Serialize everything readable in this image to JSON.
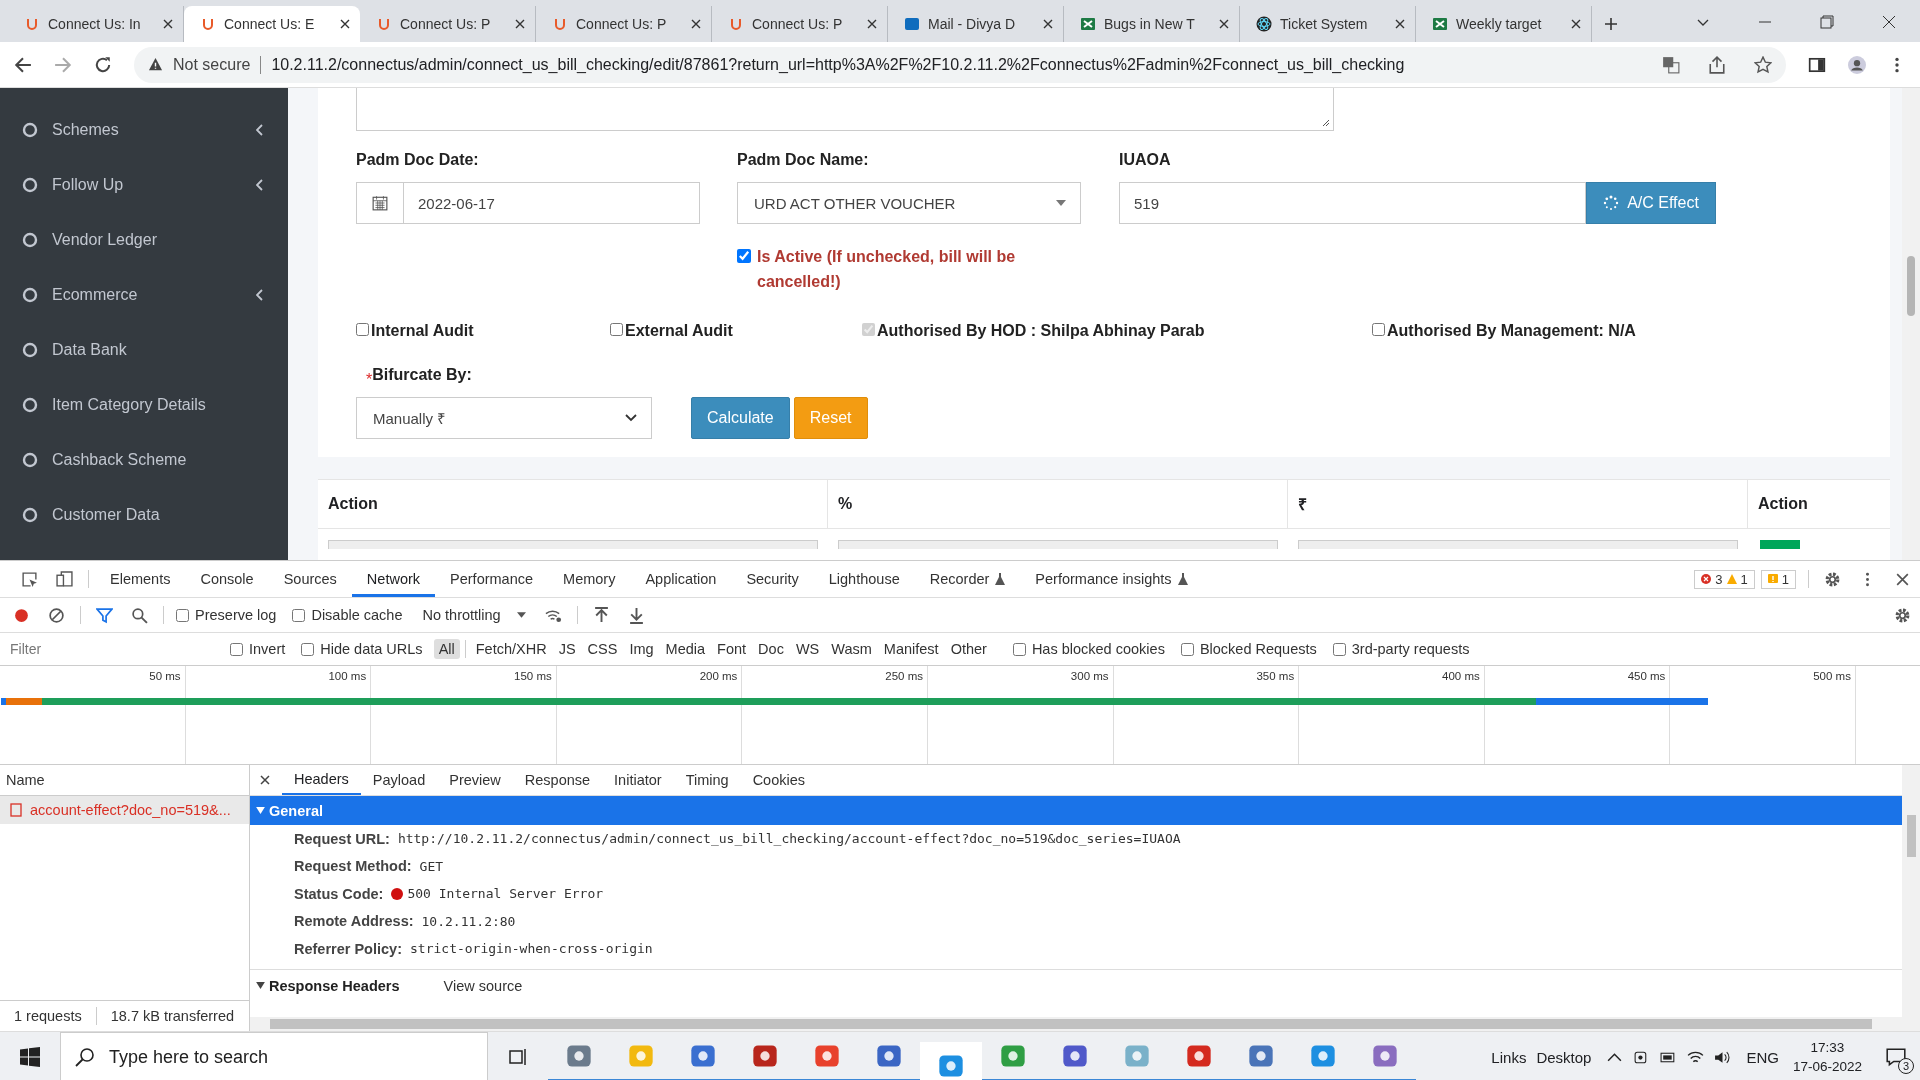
{
  "browser": {
    "tabs": [
      {
        "title": "Connect Us: In",
        "kind": "site",
        "selected": false
      },
      {
        "title": "Connect Us: E",
        "kind": "site",
        "selected": true
      },
      {
        "title": "Connect Us: P",
        "kind": "site",
        "selected": false
      },
      {
        "title": "Connect Us: P",
        "kind": "site",
        "selected": false
      },
      {
        "title": "Connect Us: P",
        "kind": "site",
        "selected": false
      },
      {
        "title": "Mail - Divya D",
        "kind": "mail",
        "selected": false
      },
      {
        "title": "Bugs in New T",
        "kind": "sheet",
        "selected": false
      },
      {
        "title": "Ticket System",
        "kind": "ticket",
        "selected": false
      },
      {
        "title": "Weekly target",
        "kind": "sheet",
        "selected": false
      }
    ],
    "address": {
      "security": "Not secure",
      "url": "10.2.11.2/connectus/admin/connect_us_bill_checking/edit/87861?return_url=http%3A%2F%2F10.2.11.2%2Fconnectus%2Fadmin%2Fconnect_us_bill_checking"
    }
  },
  "sidebar": {
    "items": [
      {
        "label": "Schemes",
        "submenu": true
      },
      {
        "label": "Follow Up",
        "submenu": true
      },
      {
        "label": "Vendor Ledger",
        "submenu": false
      },
      {
        "label": "Ecommerce",
        "submenu": true
      },
      {
        "label": "Data Bank",
        "submenu": false
      },
      {
        "label": "Item Category Details",
        "submenu": false
      },
      {
        "label": "Cashback Scheme",
        "submenu": false
      },
      {
        "label": "Customer Data",
        "submenu": false
      }
    ]
  },
  "form": {
    "date": {
      "label": "Padm Doc Date:",
      "value": "2022-06-17"
    },
    "doc_name": {
      "label": "Padm Doc Name:",
      "value": "URD ACT OTHER VOUCHER"
    },
    "iuaoa": {
      "label": "IUAOA",
      "value": "519",
      "button": "A/C Effect"
    },
    "is_active": {
      "label": "Is Active (If unchecked, bill will be cancelled!)",
      "checked": true
    },
    "audits": [
      {
        "label": "Internal Audit",
        "checked": false,
        "disabled": false
      },
      {
        "label": "External Audit",
        "checked": false,
        "disabled": false
      },
      {
        "label": "Authorised By HOD : Shilpa Abhinay Parab",
        "checked": true,
        "disabled": true
      },
      {
        "label": "Authorised By Management: N/A",
        "checked": false,
        "disabled": false
      }
    ],
    "bifurcate": {
      "required_mark": "*",
      "label": "Bifurcate By:",
      "value": "Manually ₹"
    },
    "buttons": [
      {
        "label": "Calculate",
        "kind": "primary"
      },
      {
        "label": "Reset",
        "kind": "warning"
      }
    ]
  },
  "table": {
    "columns": [
      "Action",
      "%",
      "₹",
      "Action"
    ]
  },
  "devtools": {
    "tabs": [
      {
        "label": "Elements",
        "selected": false,
        "experimental": false
      },
      {
        "label": "Console",
        "selected": false,
        "experimental": false
      },
      {
        "label": "Sources",
        "selected": false,
        "experimental": false
      },
      {
        "label": "Network",
        "selected": true,
        "experimental": false
      },
      {
        "label": "Performance",
        "selected": false,
        "experimental": false
      },
      {
        "label": "Memory",
        "selected": false,
        "experimental": false
      },
      {
        "label": "Application",
        "selected": false,
        "experimental": false
      },
      {
        "label": "Security",
        "selected": false,
        "experimental": false
      },
      {
        "label": "Lighthouse",
        "selected": false,
        "experimental": false
      },
      {
        "label": "Recorder",
        "selected": false,
        "experimental": true
      },
      {
        "label": "Performance insights",
        "selected": false,
        "experimental": true
      }
    ],
    "counts": {
      "errors": "3",
      "warnings": "1",
      "issues": "1"
    },
    "toolbar": {
      "options": [
        {
          "label": "Preserve log",
          "checked": false
        },
        {
          "label": "Disable cache",
          "checked": false
        }
      ],
      "throttling": "No throttling"
    },
    "filter": {
      "placeholder": "Filter",
      "options": [
        {
          "label": "Invert",
          "checked": false
        },
        {
          "label": "Hide data URLs",
          "checked": false
        }
      ],
      "types": [
        {
          "label": "All",
          "selected": true
        },
        {
          "label": "Fetch/XHR",
          "selected": false
        },
        {
          "label": "JS",
          "selected": false
        },
        {
          "label": "CSS",
          "selected": false
        },
        {
          "label": "Img",
          "selected": false
        },
        {
          "label": "Media",
          "selected": false
        },
        {
          "label": "Font",
          "selected": false
        },
        {
          "label": "Doc",
          "selected": false
        },
        {
          "label": "WS",
          "selected": false
        },
        {
          "label": "Wasm",
          "selected": false
        },
        {
          "label": "Manifest",
          "selected": false
        },
        {
          "label": "Other",
          "selected": false
        }
      ],
      "extra": [
        {
          "label": "Has blocked cookies",
          "checked": false
        },
        {
          "label": "Blocked Requests",
          "checked": false
        },
        {
          "label": "3rd-party requests",
          "checked": false
        }
      ]
    },
    "timeline": {
      "ticks": [
        "50 ms",
        "100 ms",
        "150 ms",
        "200 ms",
        "250 ms",
        "300 ms",
        "350 ms",
        "400 ms",
        "450 ms",
        "500 ms"
      ]
    },
    "requests": {
      "column": "Name",
      "rows": [
        {
          "name": "account-effect?doc_no=519&...",
          "failed": true,
          "selected": true
        }
      ],
      "summary": [
        "1 requests",
        "18.7 kB transferred"
      ]
    },
    "details": {
      "tabs": [
        {
          "label": "Headers",
          "selected": true
        },
        {
          "label": "Payload",
          "selected": false
        },
        {
          "label": "Preview",
          "selected": false
        },
        {
          "label": "Response",
          "selected": false
        },
        {
          "label": "Initiator",
          "selected": false
        },
        {
          "label": "Timing",
          "selected": false
        },
        {
          "label": "Cookies",
          "selected": false
        }
      ],
      "general": {
        "title": "General",
        "rows": [
          {
            "key": "Request URL:",
            "value": "http://10.2.11.2/connectus/admin/connect_us_bill_checking/account-effect?doc_no=519&doc_series=IUAOA",
            "kind": "plain"
          },
          {
            "key": "Request Method:",
            "value": "GET",
            "kind": "plain"
          },
          {
            "key": "Status Code:",
            "value": "500 Internal Server Error",
            "kind": "status"
          },
          {
            "key": "Remote Address:",
            "value": "10.2.11.2:80",
            "kind": "plain"
          },
          {
            "key": "Referrer Policy:",
            "value": "strict-origin-when-cross-origin",
            "kind": "plain"
          }
        ]
      },
      "response_headers": {
        "title": "Response Headers",
        "link": "View source"
      }
    }
  },
  "taskbar": {
    "search_placeholder": "Type here to search",
    "links": [
      "Links",
      "Desktop"
    ],
    "language": "ENG",
    "time": "17:33",
    "date": "17-06-2022",
    "notifications": "3"
  }
}
